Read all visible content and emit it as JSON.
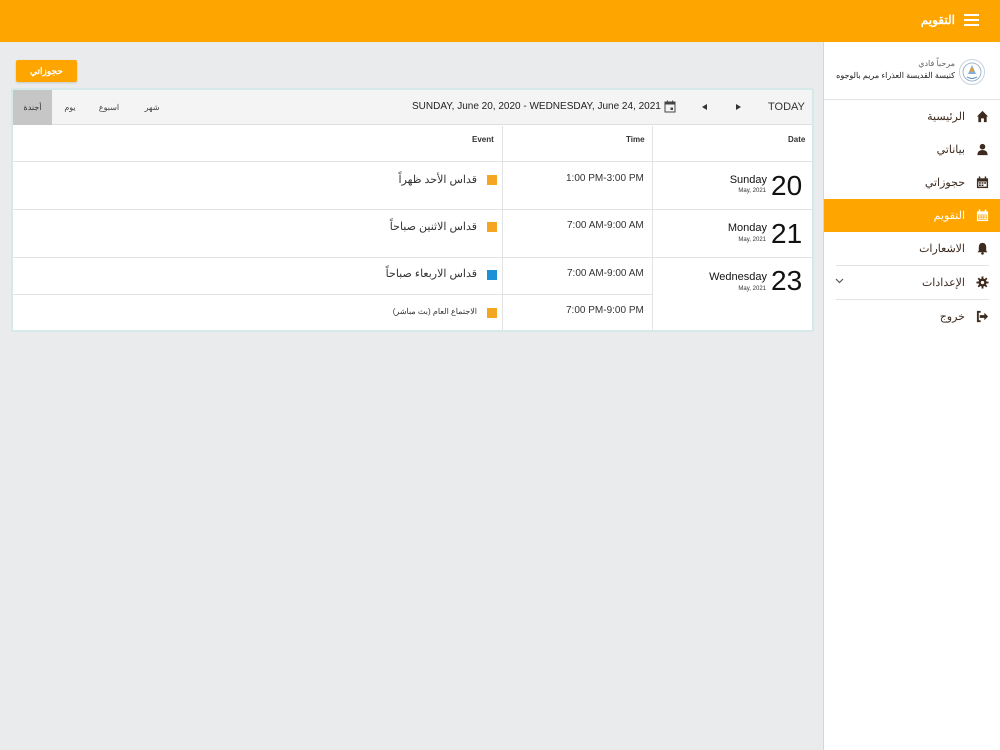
{
  "topbar": {
    "title": "التقويم",
    "menu_icon": "hamburger-icon"
  },
  "sidebar": {
    "greeting": "مرحباً فادي",
    "church_name": "كنيسة القديسة العذراء مريم بالوجوه",
    "items": [
      {
        "label": "الرئيسية",
        "icon": "home-icon"
      },
      {
        "label": "بياناتي",
        "icon": "user-icon"
      },
      {
        "label": "حجوزاتي",
        "icon": "calendar-icon"
      },
      {
        "label": "التقويم",
        "icon": "calendar-grid-icon",
        "active": true
      },
      {
        "label": "الاشعارات",
        "icon": "bell-icon"
      },
      {
        "label": "الإعدادات",
        "icon": "gear-icon"
      },
      {
        "label": "خروج",
        "icon": "logout-icon"
      }
    ]
  },
  "reservations_button": "حجوزاتي",
  "calendar": {
    "views": [
      "شهر",
      "اسبوع",
      "يوم",
      "أجندة"
    ],
    "active_view": "أجندة",
    "date_range": "SUNDAY, June 20, 2020 - WEDNESDAY, June 24, 2021",
    "today_label": "TODAY",
    "headers": {
      "event": "Event",
      "time": "Time",
      "date": "Date"
    },
    "days": [
      {
        "num": "20",
        "name": "Sunday",
        "month": "May, 2021"
      },
      {
        "num": "21",
        "name": "Monday",
        "month": "May, 2021"
      },
      {
        "num": "23",
        "name": "Wednesday",
        "month": "May, 2021"
      }
    ],
    "events": [
      {
        "time": "1:00 PM-3:00 PM",
        "title": "قداس الأحد ظهراً",
        "color": "#f4a623"
      },
      {
        "time": "7:00 AM-9:00 AM",
        "title": "قداس الاثنين صباحاً",
        "color": "#f4a623"
      },
      {
        "time": "7:00 AM-9:00 AM",
        "title": "قداس الاربعاء صباحاً",
        "color": "#1e90d8"
      },
      {
        "time": "7:00 PM-9:00 PM",
        "title": "الاجتماع العام (بث مباشر)",
        "color": "#f4a623"
      }
    ]
  },
  "colors": {
    "accent": "#ffa500",
    "background": "#e9ebec"
  }
}
